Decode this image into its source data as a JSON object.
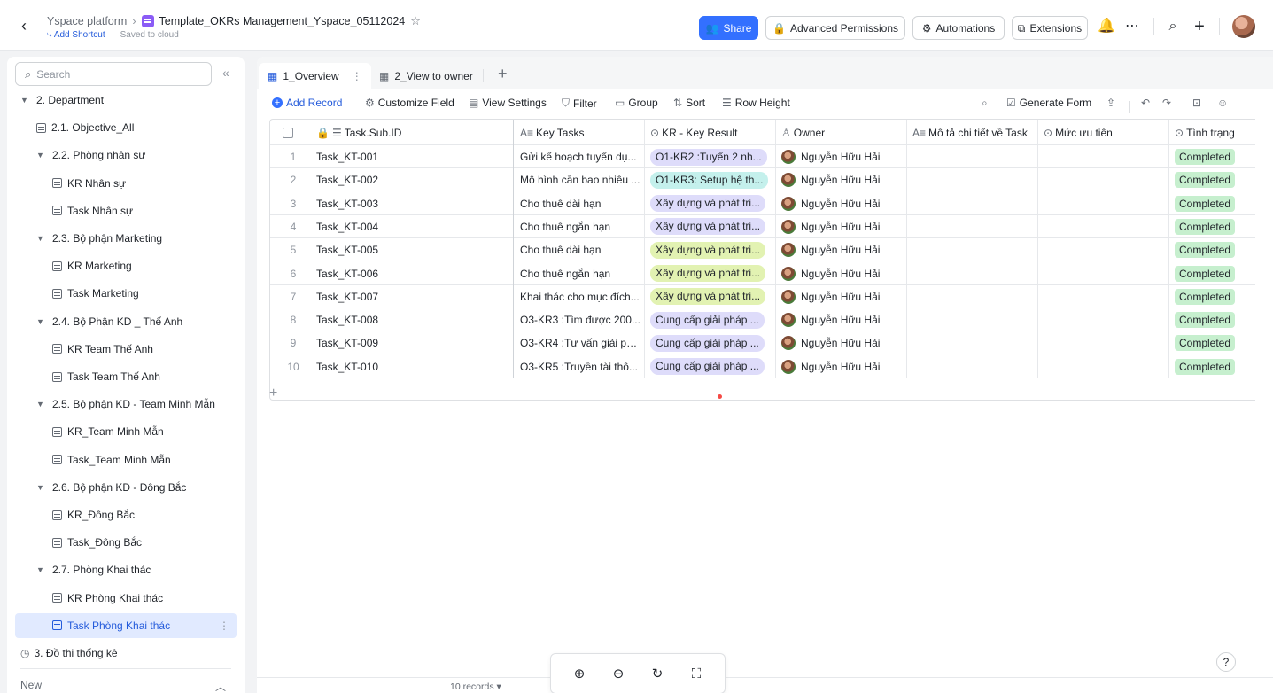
{
  "header": {
    "workspace": "Yspace platform",
    "doc_title": "Template_OKRs Management_Yspace_05112024",
    "add_shortcut": "Add Shortcut",
    "saved": "Saved to cloud",
    "share": "Share",
    "advanced_permissions": "Advanced Permissions",
    "automations": "Automations",
    "extensions": "Extensions"
  },
  "sidebar": {
    "search_placeholder": "Search",
    "items": [
      {
        "label": "2. Department",
        "type": "group",
        "level": 0
      },
      {
        "label": "2.1. Objective_All",
        "type": "table",
        "level": 1
      },
      {
        "label": "2.2. Phòng nhân sự",
        "type": "group",
        "level": 1
      },
      {
        "label": "KR Nhân sự",
        "type": "table",
        "level": 2
      },
      {
        "label": "Task Nhân sự",
        "type": "table",
        "level": 2
      },
      {
        "label": "2.3. Bộ phận Marketing",
        "type": "group",
        "level": 1
      },
      {
        "label": "KR Marketing",
        "type": "table",
        "level": 2
      },
      {
        "label": "Task Marketing",
        "type": "table",
        "level": 2
      },
      {
        "label": "2.4. Bộ Phận KD _ Thế Anh",
        "type": "group",
        "level": 1
      },
      {
        "label": "KR Team Thế Anh",
        "type": "table",
        "level": 2
      },
      {
        "label": "Task Team Thế Anh",
        "type": "table",
        "level": 2
      },
      {
        "label": "2.5. Bộ phận KD - Team Minh Mẫn",
        "type": "group",
        "level": 1
      },
      {
        "label": "KR_Team Minh Mẫn",
        "type": "table",
        "level": 2
      },
      {
        "label": "Task_Team Minh Mẫn",
        "type": "table",
        "level": 2
      },
      {
        "label": "2.6. Bộ phận KD - Đông Bắc",
        "type": "group",
        "level": 1
      },
      {
        "label": "KR_Đông Bắc",
        "type": "table",
        "level": 2
      },
      {
        "label": "Task_Đông Bắc",
        "type": "table",
        "level": 2
      },
      {
        "label": "2.7. Phòng Khai thác",
        "type": "group",
        "level": 1
      },
      {
        "label": "KR Phòng Khai thác",
        "type": "table",
        "level": 2
      },
      {
        "label": "Task Phòng Khai thác",
        "type": "table",
        "level": 2,
        "active": true
      },
      {
        "label": "3. Đồ thị thống kê",
        "type": "chart",
        "level": 0
      }
    ],
    "new_label": "New"
  },
  "tabs": [
    {
      "label": "1_Overview",
      "active": true
    },
    {
      "label": "2_View to owner",
      "active": false
    }
  ],
  "toolbar": {
    "add_record": "Add Record",
    "customize_field": "Customize Field",
    "view_settings": "View Settings",
    "filter": "Filter",
    "group": "Group",
    "sort": "Sort",
    "row_height": "Row Height",
    "generate_form": "Generate Form"
  },
  "table": {
    "columns": [
      "Task.Sub.ID",
      "Key Tasks",
      "KR - Key Result",
      "Owner",
      "Mô tả chi tiết về Task",
      "Mức ưu tiên",
      "Tình trạng"
    ],
    "rows": [
      {
        "n": "1",
        "id": "Task_KT-001",
        "task": "Gửi kế hoạch tuyển dụ...",
        "kr": "O1-KR2 :Tuyển 2 nh...",
        "kr_color": "purple",
        "owner": "Nguyễn Hữu Hải",
        "status": "Completed"
      },
      {
        "n": "2",
        "id": "Task_KT-002",
        "task": "Mô hình cần bao nhiêu ...",
        "kr": "O1-KR3: Setup hệ th...",
        "kr_color": "teal",
        "owner": "Nguyễn Hữu Hải",
        "status": "Completed"
      },
      {
        "n": "3",
        "id": "Task_KT-003",
        "task": "Cho thuê dài hạn",
        "kr": "Xây dựng và phát tri...",
        "kr_color": "purple",
        "owner": "Nguyễn Hữu Hải",
        "status": "Completed"
      },
      {
        "n": "4",
        "id": "Task_KT-004",
        "task": "Cho thuê ngắn hạn",
        "kr": "Xây dựng và phát tri...",
        "kr_color": "purple",
        "owner": "Nguyễn Hữu Hải",
        "status": "Completed"
      },
      {
        "n": "5",
        "id": "Task_KT-005",
        "task": "Cho thuê dài hạn",
        "kr": "Xây dựng và phát tri...",
        "kr_color": "lime",
        "owner": "Nguyễn Hữu Hải",
        "status": "Completed"
      },
      {
        "n": "6",
        "id": "Task_KT-006",
        "task": "Cho thuê ngắn hạn",
        "kr": "Xây dựng và phát tri...",
        "kr_color": "lime",
        "owner": "Nguyễn Hữu Hải",
        "status": "Completed"
      },
      {
        "n": "7",
        "id": "Task_KT-007",
        "task": "Khai thác cho mục đích...",
        "kr": "Xây dựng và phát tri...",
        "kr_color": "lime",
        "owner": "Nguyễn Hữu Hải",
        "status": "Completed"
      },
      {
        "n": "8",
        "id": "Task_KT-008",
        "task": "O3-KR3 :Tìm được 200...",
        "kr": "Cung cấp giải pháp ...",
        "kr_color": "purple",
        "owner": "Nguyễn Hữu Hải",
        "status": "Completed"
      },
      {
        "n": "9",
        "id": "Task_KT-009",
        "task": "O3-KR4 :Tư vấn giải ph...",
        "kr": "Cung cấp giải pháp ...",
        "kr_color": "purple",
        "owner": "Nguyễn Hữu Hải",
        "status": "Completed"
      },
      {
        "n": "10",
        "id": "Task_KT-010",
        "task": "O3-KR5 :Truyền tài thô...",
        "kr": "Cung cấp giải pháp ...",
        "kr_color": "purple",
        "owner": "Nguyễn Hữu Hải",
        "status": "Completed"
      }
    ]
  },
  "footer": {
    "records": "10 records"
  },
  "colors": {
    "accent": "#3370ff",
    "status_completed": "#c6efce",
    "tag_purple": "#dedcfa",
    "tag_teal": "#c4f0ec",
    "tag_lime": "#e2f2b2"
  }
}
